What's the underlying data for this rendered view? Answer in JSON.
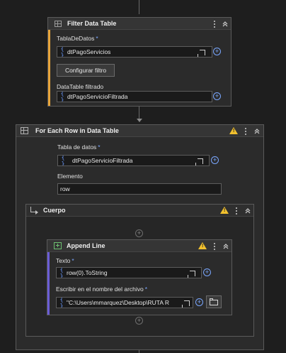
{
  "filter": {
    "title": "Filter Data Table",
    "input_label": "TablaDeDatos",
    "input_value": "dtPagoServicios",
    "button": "Configurar filtro",
    "output_label": "DataTable filtrado",
    "output_value": "dtPagoServicioFiltrada"
  },
  "foreach": {
    "title": "For Each Row in Data Table",
    "table_label": "Tabla de datos",
    "table_value": "dtPagoServicioFiltrada",
    "element_label": "Elemento",
    "element_value": "row"
  },
  "body": {
    "title": "Cuerpo"
  },
  "append": {
    "title": "Append Line",
    "text_label": "Texto",
    "text_value": "row(0).ToString",
    "file_label": "Escribir en el nombre del archivo",
    "file_value": "\"C:\\Users\\mmarquez\\Desktop\\RUTA R"
  },
  "common": {
    "required_mark": "*",
    "brace": "{ }",
    "plus": "+"
  },
  "colors": {
    "filter_accent": "#e8a53a",
    "append_accent": "#6a5cd6",
    "warning": "#f2c12e",
    "link_blue": "#7aa7ff"
  },
  "icons": [
    "filter-table-icon",
    "foreach-icon",
    "append-line-icon",
    "warning-icon",
    "more-icon",
    "collapse-icon",
    "expand-icon",
    "add-icon",
    "folder-icon",
    "body-branch-icon"
  ]
}
